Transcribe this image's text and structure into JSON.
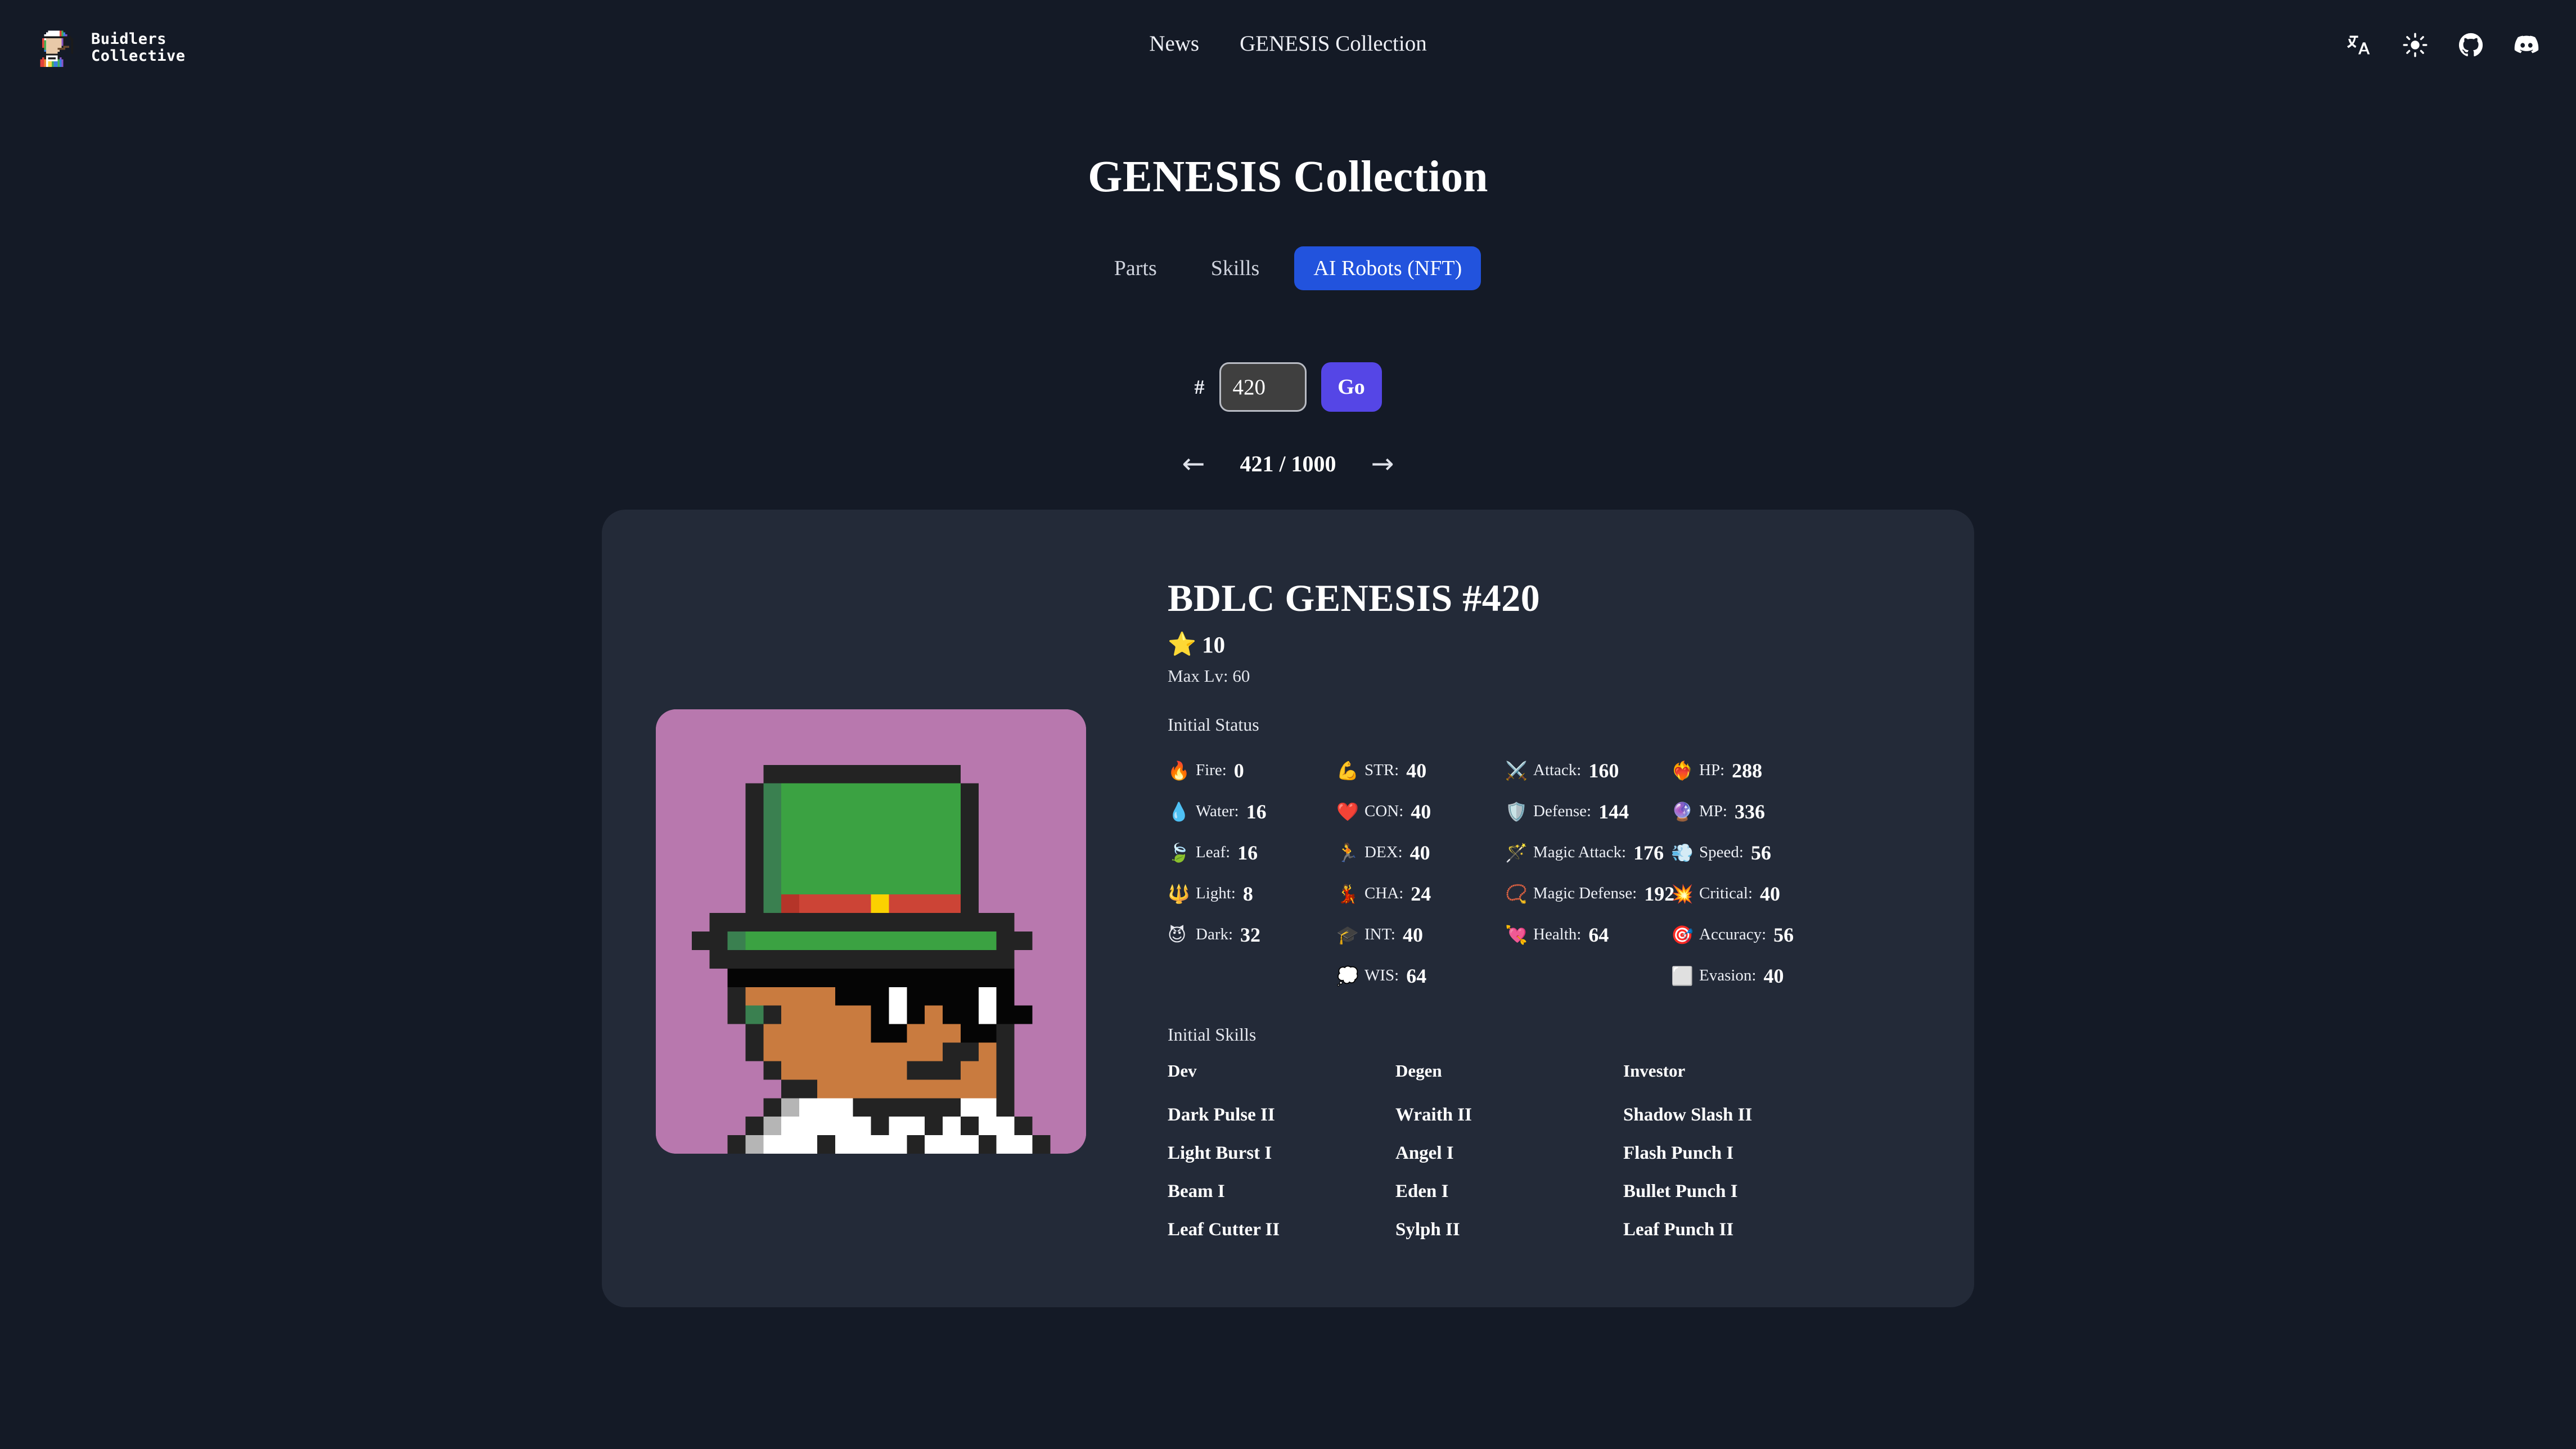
{
  "brand": {
    "line1": "Buidlers",
    "line2": "Collective",
    "logo_icon": "pixel-avatar-logo"
  },
  "header": {
    "nav": [
      {
        "label": "News",
        "name": "nav-news"
      },
      {
        "label": "GENESIS Collection",
        "name": "nav-genesis-collection"
      }
    ],
    "icons": [
      {
        "name": "translate-icon",
        "title": "Language"
      },
      {
        "name": "sun-icon",
        "title": "Theme"
      },
      {
        "name": "github-icon",
        "title": "GitHub"
      },
      {
        "name": "discord-icon",
        "title": "Discord"
      }
    ]
  },
  "page": {
    "title": "GENESIS Collection"
  },
  "tabs": [
    {
      "label": "Parts",
      "active": false
    },
    {
      "label": "Skills",
      "active": false
    },
    {
      "label": "AI Robots (NFT)",
      "active": true
    }
  ],
  "search": {
    "hash": "#",
    "value": "420",
    "placeholder": "420",
    "go_label": "Go"
  },
  "pagination": {
    "prev_icon": "←",
    "next_icon": "→",
    "label": "421 / 1000",
    "current": 421,
    "total": 1000
  },
  "nft": {
    "title": "BDLC GENESIS #420",
    "rarity_icon": "⭐",
    "rarity": "10",
    "max_level": "Max Lv: 60",
    "image_alt": "BDLC GENESIS #420 pixel art",
    "art": {
      "background": "#b878ae",
      "palette": {
        "bg": "#b878ae",
        "dark": "#232323",
        "black": "#050505",
        "green": "#3ba242",
        "green_dark": "#3a8050",
        "red": "#cc4436",
        "red_dark": "#b53529",
        "yellow": "#fbd100",
        "skin": "#c97b3f",
        "white": "#ffffff",
        "gray": "#b5b5b5"
      }
    }
  },
  "status": {
    "label": "Initial Status",
    "columns": [
      {
        "name": "elements",
        "rows": [
          {
            "icon": "🔥",
            "icon_name": "fire-icon",
            "label": "Fire",
            "value": "0"
          },
          {
            "icon": "💧",
            "icon_name": "water-icon",
            "label": "Water",
            "value": "16"
          },
          {
            "icon": "🍃",
            "icon_name": "leaf-icon",
            "label": "Leaf",
            "value": "16"
          },
          {
            "icon": "🔱",
            "icon_name": "light-icon",
            "label": "Light",
            "value": "8"
          },
          {
            "icon": "😈",
            "icon_name": "dark-icon",
            "label": "Dark",
            "value": "32"
          }
        ]
      },
      {
        "name": "attributes",
        "rows": [
          {
            "icon": "💪",
            "icon_name": "strength-icon",
            "label": "STR",
            "value": "40"
          },
          {
            "icon": "❤️",
            "icon_name": "constitution-icon",
            "label": "CON",
            "value": "40"
          },
          {
            "icon": "🏃",
            "icon_name": "dexterity-icon",
            "label": "DEX",
            "value": "40"
          },
          {
            "icon": "💃",
            "icon_name": "charisma-icon",
            "label": "CHA",
            "value": "24"
          },
          {
            "icon": "🎓",
            "icon_name": "intelligence-icon",
            "label": "INT",
            "value": "40"
          },
          {
            "icon": "💭",
            "icon_name": "wisdom-icon",
            "label": "WIS",
            "value": "64"
          }
        ]
      },
      {
        "name": "combat",
        "rows": [
          {
            "icon": "⚔️",
            "icon_name": "attack-icon",
            "label": "Attack",
            "value": "160"
          },
          {
            "icon": "🛡️",
            "icon_name": "defense-icon",
            "label": "Defense",
            "value": "144"
          },
          {
            "icon": "🪄",
            "icon_name": "magic-attack-icon",
            "label": "Magic Attack",
            "value": "176"
          },
          {
            "icon": "📿",
            "icon_name": "magic-defense-icon",
            "label": "Magic Defense",
            "value": "192"
          },
          {
            "icon": "💘",
            "icon_name": "health-icon",
            "label": "Health",
            "value": "64"
          }
        ]
      },
      {
        "name": "vitals",
        "rows": [
          {
            "icon": "❤️‍🔥",
            "icon_name": "hp-icon",
            "label": "HP",
            "value": "288"
          },
          {
            "icon": "🔮",
            "icon_name": "mp-icon",
            "label": "MP",
            "value": "336"
          },
          {
            "icon": "💨",
            "icon_name": "speed-icon",
            "label": "Speed",
            "value": "56"
          },
          {
            "icon": "💥",
            "icon_name": "critical-icon",
            "label": "Critical",
            "value": "40"
          },
          {
            "icon": "🎯",
            "icon_name": "accuracy-icon",
            "label": "Accuracy",
            "value": "56"
          },
          {
            "icon": "⬜",
            "icon_name": "evasion-icon",
            "label": "Evasion",
            "value": "40"
          }
        ]
      }
    ]
  },
  "skills": {
    "label": "Initial Skills",
    "columns": [
      {
        "header": "Dev",
        "items": [
          "Dark Pulse II",
          "Light Burst I",
          "Beam I",
          "Leaf Cutter II"
        ]
      },
      {
        "header": "Degen",
        "items": [
          "Wraith II",
          "Angel I",
          "Eden I",
          "Sylph II"
        ]
      },
      {
        "header": "Investor",
        "items": [
          "Shadow Slash II",
          "Flash Punch I",
          "Bullet Punch I",
          "Leaf Punch II"
        ]
      }
    ]
  },
  "colors": {
    "page_bg": "#141a26",
    "card_bg": "#232a38",
    "accent_tab": "#2253dd",
    "accent_go": "#5546e6"
  }
}
